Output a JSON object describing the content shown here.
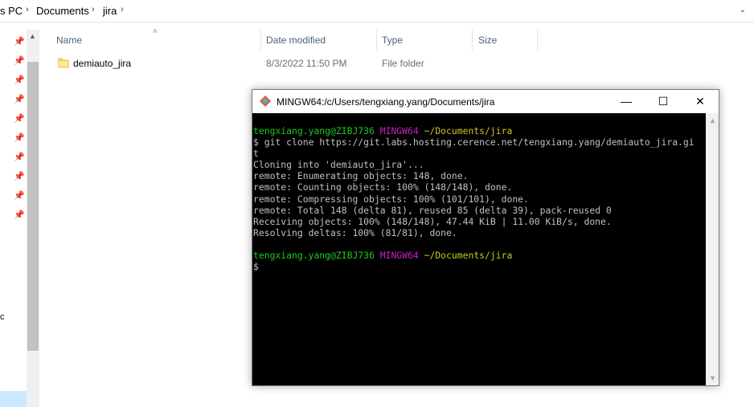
{
  "breadcrumb": {
    "items": [
      "s PC",
      "Documents",
      "jira"
    ],
    "separator": "›"
  },
  "columns": {
    "name": "Name",
    "date_modified": "Date modified",
    "type": "Type",
    "size": "Size"
  },
  "files": [
    {
      "name": "demiauto_jira",
      "date_modified": "8/3/2022 11:50 PM",
      "type": "File folder",
      "size": ""
    }
  ],
  "nav": {
    "partial_label": "c"
  },
  "terminal": {
    "title": "MINGW64:/c/Users/tengxiang.yang/Documents/jira",
    "controls": {
      "minimize": "—",
      "maximize": "☐",
      "close": "✕"
    },
    "lines": [
      {
        "user": "tengxiang.yang@ZIBJ736",
        "shell": "MINGW64",
        "path": "~/Documents/jira"
      },
      {
        "text": "$ git clone https://git.labs.hosting.cerence.net/tengxiang.yang/demiauto_jira.gi"
      },
      {
        "text": "t"
      },
      {
        "text": "Cloning into 'demiauto_jira'..."
      },
      {
        "text": "remote: Enumerating objects: 148, done."
      },
      {
        "text": "remote: Counting objects: 100% (148/148), done."
      },
      {
        "text": "remote: Compressing objects: 100% (101/101), done."
      },
      {
        "text": "remote: Total 148 (delta 81), reused 85 (delta 39), pack-reused 0"
      },
      {
        "text": "Receiving objects: 100% (148/148), 47.44 KiB | 11.00 KiB/s, done."
      },
      {
        "text": "Resolving deltas: 100% (81/81), done."
      },
      {
        "text": ""
      },
      {
        "user": "tengxiang.yang@ZIBJ736",
        "shell": "MINGW64",
        "path": "~/Documents/jira"
      },
      {
        "text": "$"
      }
    ]
  },
  "colors": {
    "prompt_user": "#1fc91f",
    "prompt_shell": "#c71fc7",
    "prompt_path": "#c8c81f",
    "terminal_bg": "#000000",
    "header_text": "#4c607a",
    "folder": "#f8d775"
  }
}
